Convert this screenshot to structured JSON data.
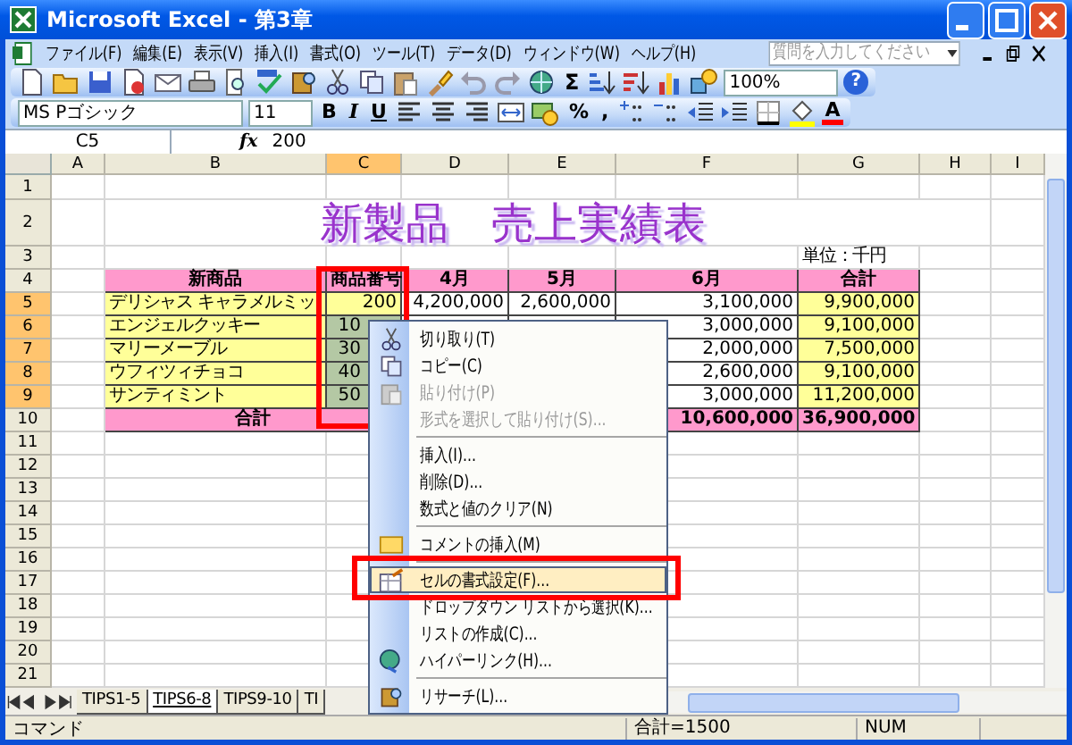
{
  "window": {
    "title": "Microsoft Excel - 第3章"
  },
  "menu": [
    {
      "label": "ファイル(F)"
    },
    {
      "label": "編集(E)"
    },
    {
      "label": "表示(V)"
    },
    {
      "label": "挿入(I)"
    },
    {
      "label": "書式(O)"
    },
    {
      "label": "ツール(T)"
    },
    {
      "label": "データ(D)"
    },
    {
      "label": "ウィンドウ(W)"
    },
    {
      "label": "ヘルプ(H)"
    }
  ],
  "help_search": {
    "placeholder": "質問を入力してください"
  },
  "standard_toolbar": {
    "sum": "Σ",
    "zoom": "100%",
    "help": "?"
  },
  "formatting_toolbar": {
    "font": "MS Pゴシック",
    "size": "11",
    "bold": "B",
    "italic": "I",
    "underline": "U",
    "percent": "%",
    "comma": ",",
    "font_color": "A"
  },
  "formula_bar": {
    "name_box": "C5",
    "function_label": "fx",
    "value": "200"
  },
  "sheet": {
    "columns": [
      {
        "label": "A",
        "selected": false
      },
      {
        "label": "B",
        "selected": false
      },
      {
        "label": "C",
        "selected": true
      },
      {
        "label": "D",
        "selected": false
      },
      {
        "label": "E",
        "selected": false
      },
      {
        "label": "F",
        "selected": false
      },
      {
        "label": "G",
        "selected": false
      },
      {
        "label": "H",
        "selected": false
      },
      {
        "label": "I",
        "selected": false
      }
    ],
    "rows": [
      {
        "label": "1",
        "selected": false,
        "kind": "plain"
      },
      {
        "label": "2",
        "selected": false,
        "kind": "title",
        "cells": {
          "B": {
            "text": "新製品　売上実績表",
            "selected": false
          }
        }
      },
      {
        "label": "3",
        "selected": false,
        "kind": "plain",
        "cells": {
          "G": {
            "text": "単位：千円",
            "selected": false
          }
        }
      },
      {
        "label": "4",
        "selected": false,
        "kind": "header",
        "cells": {
          "B": {
            "text": "新商品",
            "selected": false
          },
          "C": {
            "text": "商品番号",
            "selected": false
          },
          "D": {
            "text": "4月",
            "selected": false
          },
          "E": {
            "text": "5月",
            "selected": false
          },
          "F": {
            "text": "6月",
            "selected": false
          },
          "G": {
            "text": "合計",
            "selected": false
          }
        }
      },
      {
        "label": "5",
        "selected": true,
        "kind": "item",
        "cells": {
          "B": {
            "text": "デリシャス キャラメルミッ",
            "selected": false
          },
          "C": {
            "text": "200",
            "selected": false
          },
          "D": {
            "text": "4,200,000",
            "selected": false
          },
          "E": {
            "text": "2,600,000",
            "selected": false
          },
          "F": {
            "text": "3,100,000",
            "selected": false
          },
          "G": {
            "text": "9,900,000",
            "selected": false
          }
        }
      },
      {
        "label": "6",
        "selected": true,
        "kind": "item",
        "cells": {
          "B": {
            "text": "エンジェルクッキー",
            "selected": false
          },
          "C": {
            "text": "10",
            "selected": true
          },
          "F": {
            "text": "3,000,000",
            "selected": false
          },
          "G": {
            "text": "9,100,000",
            "selected": false
          }
        }
      },
      {
        "label": "7",
        "selected": true,
        "kind": "item",
        "cells": {
          "B": {
            "text": "マリーメーブル",
            "selected": false
          },
          "C": {
            "text": "30",
            "selected": true
          },
          "F": {
            "text": "2,000,000",
            "selected": false
          },
          "G": {
            "text": "7,500,000",
            "selected": false
          }
        }
      },
      {
        "label": "8",
        "selected": true,
        "kind": "item",
        "cells": {
          "B": {
            "text": "ウフィツィチョコ",
            "selected": false
          },
          "C": {
            "text": "40",
            "selected": true
          },
          "F": {
            "text": "2,600,000",
            "selected": false
          },
          "G": {
            "text": "9,100,000",
            "selected": false
          }
        }
      },
      {
        "label": "9",
        "selected": true,
        "kind": "item",
        "cells": {
          "B": {
            "text": "サンティミント",
            "selected": false
          },
          "C": {
            "text": "50",
            "selected": true
          },
          "F": {
            "text": "3,000,000",
            "selected": false
          },
          "G": {
            "text": "11,200,000",
            "selected": false
          }
        }
      },
      {
        "label": "10",
        "selected": false,
        "kind": "total",
        "cells": {
          "B": {
            "text": "合計",
            "selected": false
          },
          "F": {
            "text": "10,600,000",
            "selected": false
          },
          "G": {
            "text": "36,900,000",
            "selected": false
          }
        }
      },
      {
        "label": "11",
        "selected": false,
        "kind": "plain"
      },
      {
        "label": "12",
        "selected": false,
        "kind": "plain"
      },
      {
        "label": "13",
        "selected": false,
        "kind": "plain"
      },
      {
        "label": "14",
        "selected": false,
        "kind": "plain"
      },
      {
        "label": "15",
        "selected": false,
        "kind": "plain"
      },
      {
        "label": "16",
        "selected": false,
        "kind": "plain"
      },
      {
        "label": "17",
        "selected": false,
        "kind": "plain"
      },
      {
        "label": "18",
        "selected": false,
        "kind": "plain"
      },
      {
        "label": "19",
        "selected": false,
        "kind": "plain"
      },
      {
        "label": "20",
        "selected": false,
        "kind": "plain"
      },
      {
        "label": "21",
        "selected": false,
        "kind": "plain"
      }
    ]
  },
  "sheet_tabs": [
    {
      "label": "TIPS1-5",
      "selected": false
    },
    {
      "label": "TIPS6-8",
      "selected": true
    },
    {
      "label": "TIPS9-10",
      "selected": false
    },
    {
      "label": "TI",
      "selected": false
    }
  ],
  "context_menu": [
    {
      "label": "切り取り(T)",
      "disabled": false,
      "selected": false,
      "separator_before": false
    },
    {
      "label": "コピー(C)",
      "disabled": false,
      "selected": false,
      "separator_before": false
    },
    {
      "label": "貼り付け(P)",
      "disabled": true,
      "selected": false,
      "separator_before": false
    },
    {
      "label": "形式を選択して貼り付け(S)...",
      "disabled": true,
      "selected": false,
      "separator_before": false
    },
    {
      "label": "挿入(I)...",
      "disabled": false,
      "selected": false,
      "separator_before": true
    },
    {
      "label": "削除(D)...",
      "disabled": false,
      "selected": false,
      "separator_before": false
    },
    {
      "label": "数式と値のクリア(N)",
      "disabled": false,
      "selected": false,
      "separator_before": false
    },
    {
      "label": "コメントの挿入(M)",
      "disabled": false,
      "selected": false,
      "separator_before": true
    },
    {
      "label": "セルの書式設定(F)...",
      "disabled": false,
      "selected": true,
      "separator_before": true
    },
    {
      "label": "ドロップダウン リストから選択(K)...",
      "disabled": false,
      "selected": false,
      "separator_before": false
    },
    {
      "label": "リストの作成(C)...",
      "disabled": false,
      "selected": false,
      "separator_before": false
    },
    {
      "label": "ハイパーリンク(H)...",
      "disabled": false,
      "selected": false,
      "separator_before": false
    },
    {
      "label": "リサーチ(L)...",
      "disabled": false,
      "selected": false,
      "separator_before": true
    }
  ],
  "status_bar": {
    "mode": "コマンド",
    "sum": "合計=1500",
    "num": "NUM"
  }
}
